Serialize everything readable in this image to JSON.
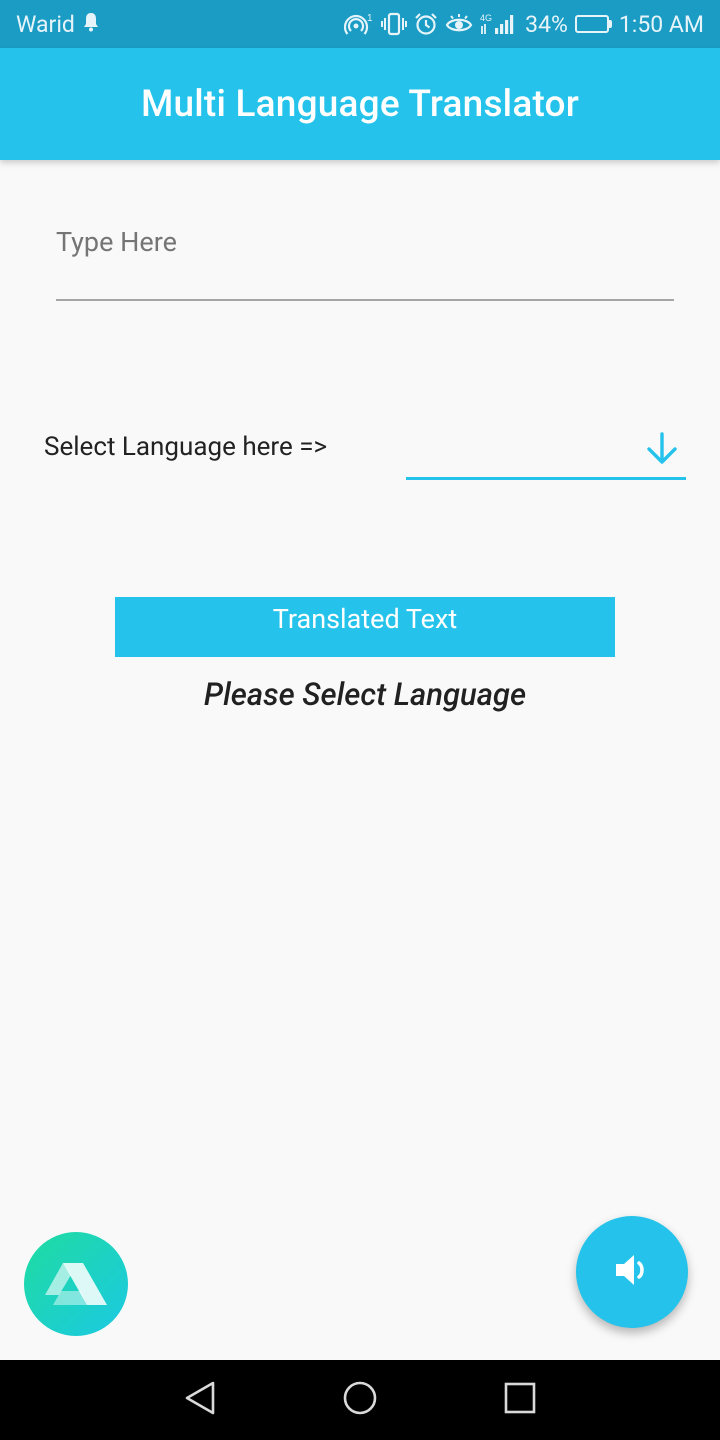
{
  "status_bar": {
    "carrier": "Warid",
    "network_type": "4G",
    "battery_percent": "34%",
    "battery_level": 0.34,
    "time": "1:50 AM",
    "icons": [
      "notification-bell-icon",
      "hotspot-icon",
      "vibrate-icon",
      "alarm-icon",
      "eye-comfort-icon",
      "signal-icon",
      "battery-icon"
    ]
  },
  "app_bar": {
    "title": "Multi Language Translator"
  },
  "input": {
    "placeholder": "Type Here",
    "value": ""
  },
  "language_select": {
    "label": "Select Language here =>",
    "selected": "",
    "icon": "arrow-down-icon"
  },
  "result": {
    "header": "Translated Text",
    "text": "Please Select Language"
  },
  "fab": {
    "icon": "volume-icon"
  },
  "logo": {
    "icon": "app-logo-icon"
  },
  "nav_bar": {
    "buttons": [
      "back-icon",
      "home-icon",
      "recents-icon"
    ]
  },
  "colors": {
    "status_bar": "#1a9cc4",
    "primary": "#25c3eb",
    "background": "#f9f9f9",
    "logo_gradient_start": "#1fdca0",
    "logo_gradient_end": "#1bc9e3"
  }
}
